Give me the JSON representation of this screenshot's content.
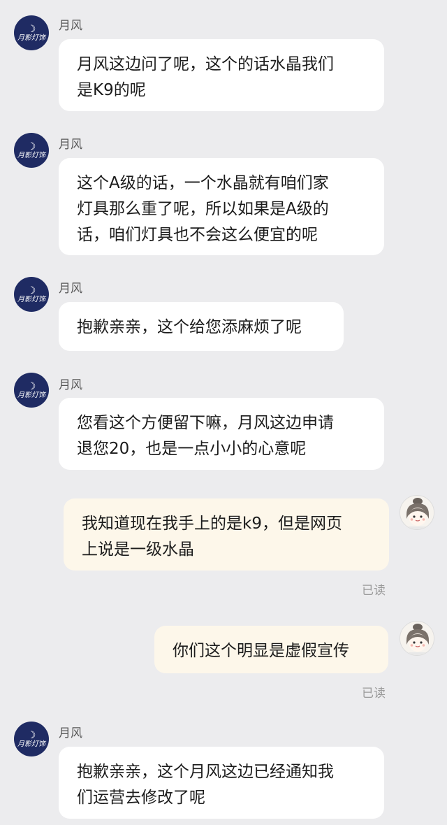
{
  "shop_avatar": {
    "moon_glyph": "☽",
    "brand_text": "月影灯饰"
  },
  "messages": [
    {
      "sender": "月风",
      "text": "月风这边问了呢，这个的话水晶我们\n是K9的呢"
    },
    {
      "sender": "月风",
      "text": "这个A级的话，一个水晶就有咱们家\n灯具那么重了呢，所以如果是A级的\n话，咱们灯具也不会这么便宜的呢"
    },
    {
      "sender": "月风",
      "text": "抱歉亲亲，这个给您添麻烦了呢"
    },
    {
      "sender": "月风",
      "text": "您看这个方便留下嘛，月风这边申请\n退您20，也是一点小小的心意呢"
    },
    {
      "sender": "me",
      "text": "我知道现在我手上的是k9，但是网页\n上说是一级水晶",
      "status": "已读"
    },
    {
      "sender": "me",
      "text": "你们这个明显是虚假宣传",
      "status": "已读"
    },
    {
      "sender": "月风",
      "text": "抱歉亲亲，这个月风这边已经通知我\n们运营去修改了呢"
    }
  ]
}
